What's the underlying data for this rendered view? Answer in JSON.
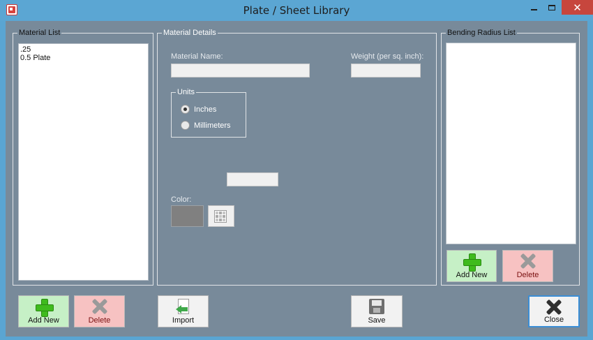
{
  "window": {
    "title": "Plate / Sheet Library",
    "close_glyph": "✕"
  },
  "material_list": {
    "legend": "Material List",
    "items": [
      ".25",
      "0.5 Plate"
    ],
    "add_label": "Add New",
    "delete_label": "Delete"
  },
  "material_details": {
    "legend": "Material Details",
    "name_label": "Material Name:",
    "name_value": "",
    "weight_label": "Weight (per sq. inch):",
    "weight_value": "",
    "units_legend": "Units",
    "units_options": [
      "Inches",
      "Millimeters"
    ],
    "units_selected": "Inches",
    "extra_value": "",
    "color_label": "Color:",
    "color_value": "#808080"
  },
  "bending_radius": {
    "legend": "Bending Radius List",
    "items": [],
    "add_label": "Add New",
    "delete_label": "Delete"
  },
  "footer": {
    "import_label": "Import",
    "save_label": "Save",
    "close_label": "Close"
  },
  "icons": [
    "app-icon",
    "minimize-icon",
    "maximize-icon",
    "close-icon",
    "plus-icon",
    "delete-x-icon",
    "import-icon",
    "save-icon",
    "color-grid-icon"
  ],
  "colors": {
    "titlebar": "#5ba6d3",
    "client": "#788a9a",
    "close_button": "#c7463d",
    "add_button": "#c6f0c6",
    "delete_button": "#f7c2c2"
  }
}
